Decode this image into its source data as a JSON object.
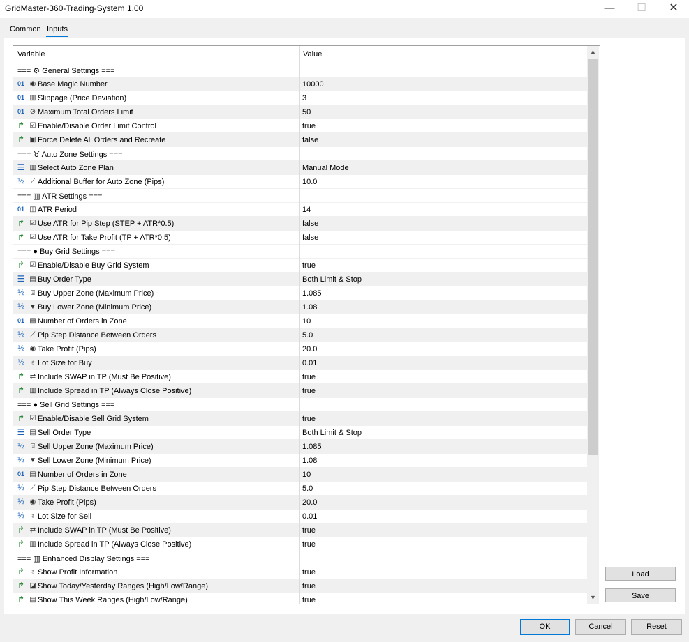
{
  "window": {
    "title": "GridMaster-360-Trading-System 1.00",
    "minimize_glyph": "—",
    "maximize_glyph": "☐",
    "close_glyph": "✕"
  },
  "tabs": [
    {
      "label": "Common"
    },
    {
      "label": "Inputs"
    }
  ],
  "grid": {
    "col_variable": "Variable",
    "col_value": "Value",
    "scroll_up_glyph": "▲",
    "scroll_down_glyph": "▼",
    "rows": [
      {
        "type": "group",
        "name": "=== ⚙ General Settings ===",
        "value": ""
      },
      {
        "type": "int",
        "sym": "◉",
        "name": "Base Magic Number",
        "value": "10000"
      },
      {
        "type": "int",
        "sym": "▥",
        "name": "Slippage (Price Deviation)",
        "value": "3"
      },
      {
        "type": "int",
        "sym": "⊘",
        "name": "Maximum Total Orders Limit",
        "value": "50"
      },
      {
        "type": "bool",
        "sym": "☑",
        "name": "Enable/Disable Order Limit Control",
        "value": "true"
      },
      {
        "type": "bool",
        "sym": "▣",
        "name": "Force Delete All Orders and Recreate",
        "value": "false"
      },
      {
        "type": "group",
        "name": "=== ♉ Auto Zone Settings ===",
        "value": ""
      },
      {
        "type": "enum",
        "sym": "▥",
        "name": "Select Auto Zone Plan",
        "value": "Manual Mode"
      },
      {
        "type": "double",
        "sym": "⟋",
        "name": "Additional Buffer for Auto Zone (Pips)",
        "value": "10.0"
      },
      {
        "type": "group",
        "name": "=== ▥ ATR Settings ===",
        "value": ""
      },
      {
        "type": "int",
        "sym": "◫",
        "name": "ATR Period",
        "value": "14"
      },
      {
        "type": "bool",
        "sym": "☑",
        "name": "Use ATR for Pip Step (STEP + ATR*0.5)",
        "value": "false"
      },
      {
        "type": "bool",
        "sym": "☑",
        "name": "Use ATR for Take Profit (TP + ATR*0.5)",
        "value": "false"
      },
      {
        "type": "group",
        "name": "=== ● Buy Grid Settings ===",
        "value": ""
      },
      {
        "type": "bool",
        "sym": "☑",
        "name": "Enable/Disable Buy Grid System",
        "value": "true"
      },
      {
        "type": "enum",
        "sym": "▤",
        "name": "Buy Order Type",
        "value": "Both Limit & Stop"
      },
      {
        "type": "double",
        "sym": "⍗",
        "name": "Buy Upper Zone (Maximum Price)",
        "value": "1.085"
      },
      {
        "type": "double",
        "sym": "▼",
        "name": "Buy Lower Zone (Minimum Price)",
        "value": "1.08"
      },
      {
        "type": "int",
        "sym": "▤",
        "name": "Number of Orders in Zone",
        "value": "10"
      },
      {
        "type": "double",
        "sym": "⟋",
        "name": "Pip Step Distance Between Orders",
        "value": "5.0"
      },
      {
        "type": "double",
        "sym": "◉",
        "name": "Take Profit (Pips)",
        "value": "20.0"
      },
      {
        "type": "double",
        "sym": "♁",
        "name": "Lot Size for Buy",
        "value": "0.01"
      },
      {
        "type": "bool",
        "sym": "⇄",
        "name": "Include SWAP in TP (Must Be Positive)",
        "value": "true"
      },
      {
        "type": "bool",
        "sym": "▥",
        "name": "Include Spread in TP (Always Close Positive)",
        "value": "true"
      },
      {
        "type": "group",
        "name": "=== ● Sell Grid Settings ===",
        "value": ""
      },
      {
        "type": "bool",
        "sym": "☑",
        "name": "Enable/Disable Sell Grid System",
        "value": "true"
      },
      {
        "type": "enum",
        "sym": "▤",
        "name": "Sell Order Type",
        "value": "Both Limit & Stop"
      },
      {
        "type": "double",
        "sym": "⍗",
        "name": "Sell Upper Zone (Maximum Price)",
        "value": "1.085"
      },
      {
        "type": "double",
        "sym": "▼",
        "name": "Sell Lower Zone (Minimum Price)",
        "value": "1.08"
      },
      {
        "type": "int",
        "sym": "▤",
        "name": "Number of Orders in Zone",
        "value": "10"
      },
      {
        "type": "double",
        "sym": "⟋",
        "name": "Pip Step Distance Between Orders",
        "value": "5.0"
      },
      {
        "type": "double",
        "sym": "◉",
        "name": "Take Profit (Pips)",
        "value": "20.0"
      },
      {
        "type": "double",
        "sym": "♁",
        "name": "Lot Size for Sell",
        "value": "0.01"
      },
      {
        "type": "bool",
        "sym": "⇄",
        "name": "Include SWAP in TP (Must Be Positive)",
        "value": "true"
      },
      {
        "type": "bool",
        "sym": "▥",
        "name": "Include Spread in TP (Always Close Positive)",
        "value": "true"
      },
      {
        "type": "group",
        "name": "=== ▥ Enhanced Display Settings ===",
        "value": ""
      },
      {
        "type": "bool",
        "sym": "♁",
        "name": "Show Profit Information",
        "value": "true"
      },
      {
        "type": "bool",
        "sym": "◪",
        "name": "Show Today/Yesterday Ranges (High/Low/Range)",
        "value": "true"
      },
      {
        "type": "bool",
        "sym": "▤",
        "name": "Show This Week Ranges (High/Low/Range)",
        "value": "true"
      }
    ]
  },
  "type_badges": {
    "int": "01",
    "bool": "↱",
    "enum": "☰",
    "double": "½"
  },
  "side_buttons": {
    "load": "Load",
    "save": "Save"
  },
  "bottom_buttons": {
    "ok": "OK",
    "cancel": "Cancel",
    "reset": "Reset"
  },
  "colors": {
    "accent": "#0078d7",
    "type_icon_blue": "#1c63b7",
    "type_icon_green": "#2e8b3e"
  }
}
